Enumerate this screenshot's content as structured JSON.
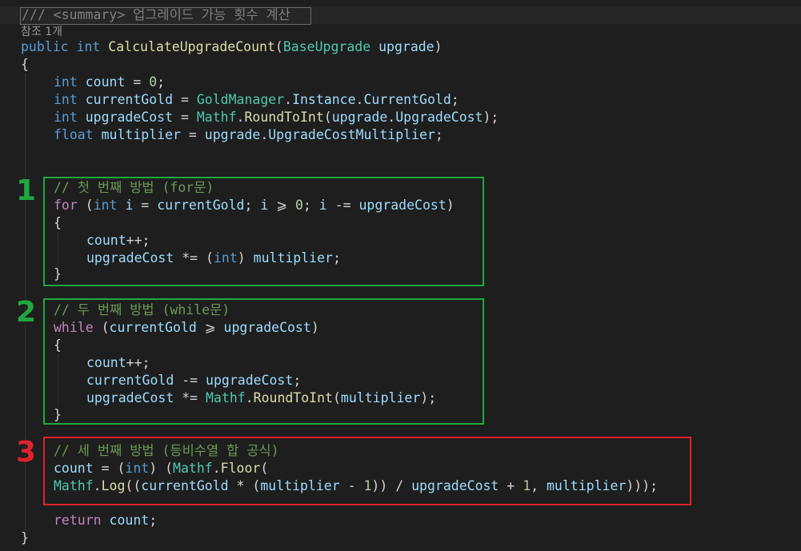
{
  "editor": {
    "codelens": "참조 1개",
    "lines": {
      "summary": "/// <summary> 업그레이드 가능 횟수 계산",
      "sig_public": "public",
      "sig_int": "int",
      "sig_name": "CalculateUpgradeCount",
      "sig_type": "BaseUpgrade",
      "sig_param": "upgrade",
      "open_brace": "{",
      "close_brace": "}"
    },
    "comments": {
      "method1": "// 첫 번째 방법 (for문)",
      "method2": "// 두 번째 방법 (while문)",
      "method3": "// 세 번째 방법 (등비수열 합 공식)"
    }
  },
  "annotations": {
    "box1_label": "1",
    "box2_label": "2",
    "box3_label": "3",
    "green_color": "#1fa841",
    "red_color": "#e0222c"
  }
}
